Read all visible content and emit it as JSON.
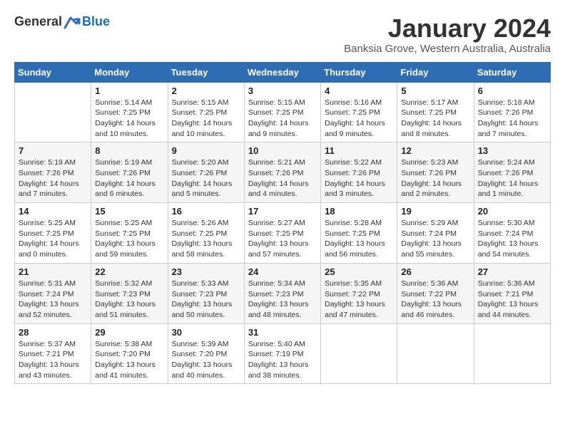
{
  "header": {
    "logo_general": "General",
    "logo_blue": "Blue",
    "month_year": "January 2024",
    "location": "Banksia Grove, Western Australia, Australia"
  },
  "calendar": {
    "headers": [
      "Sunday",
      "Monday",
      "Tuesday",
      "Wednesday",
      "Thursday",
      "Friday",
      "Saturday"
    ],
    "weeks": [
      [
        {
          "day": "",
          "info": ""
        },
        {
          "day": "1",
          "info": "Sunrise: 5:14 AM\nSunset: 7:25 PM\nDaylight: 14 hours\nand 10 minutes."
        },
        {
          "day": "2",
          "info": "Sunrise: 5:15 AM\nSunset: 7:25 PM\nDaylight: 14 hours\nand 10 minutes."
        },
        {
          "day": "3",
          "info": "Sunrise: 5:15 AM\nSunset: 7:25 PM\nDaylight: 14 hours\nand 9 minutes."
        },
        {
          "day": "4",
          "info": "Sunrise: 5:16 AM\nSunset: 7:25 PM\nDaylight: 14 hours\nand 9 minutes."
        },
        {
          "day": "5",
          "info": "Sunrise: 5:17 AM\nSunset: 7:25 PM\nDaylight: 14 hours\nand 8 minutes."
        },
        {
          "day": "6",
          "info": "Sunrise: 5:18 AM\nSunset: 7:26 PM\nDaylight: 14 hours\nand 7 minutes."
        }
      ],
      [
        {
          "day": "7",
          "info": "Sunrise: 5:19 AM\nSunset: 7:26 PM\nDaylight: 14 hours\nand 7 minutes."
        },
        {
          "day": "8",
          "info": "Sunrise: 5:19 AM\nSunset: 7:26 PM\nDaylight: 14 hours\nand 6 minutes."
        },
        {
          "day": "9",
          "info": "Sunrise: 5:20 AM\nSunset: 7:26 PM\nDaylight: 14 hours\nand 5 minutes."
        },
        {
          "day": "10",
          "info": "Sunrise: 5:21 AM\nSunset: 7:26 PM\nDaylight: 14 hours\nand 4 minutes."
        },
        {
          "day": "11",
          "info": "Sunrise: 5:22 AM\nSunset: 7:26 PM\nDaylight: 14 hours\nand 3 minutes."
        },
        {
          "day": "12",
          "info": "Sunrise: 5:23 AM\nSunset: 7:26 PM\nDaylight: 14 hours\nand 2 minutes."
        },
        {
          "day": "13",
          "info": "Sunrise: 5:24 AM\nSunset: 7:26 PM\nDaylight: 14 hours\nand 1 minute."
        }
      ],
      [
        {
          "day": "14",
          "info": "Sunrise: 5:25 AM\nSunset: 7:25 PM\nDaylight: 14 hours\nand 0 minutes."
        },
        {
          "day": "15",
          "info": "Sunrise: 5:25 AM\nSunset: 7:25 PM\nDaylight: 13 hours\nand 59 minutes."
        },
        {
          "day": "16",
          "info": "Sunrise: 5:26 AM\nSunset: 7:25 PM\nDaylight: 13 hours\nand 58 minutes."
        },
        {
          "day": "17",
          "info": "Sunrise: 5:27 AM\nSunset: 7:25 PM\nDaylight: 13 hours\nand 57 minutes."
        },
        {
          "day": "18",
          "info": "Sunrise: 5:28 AM\nSunset: 7:25 PM\nDaylight: 13 hours\nand 56 minutes."
        },
        {
          "day": "19",
          "info": "Sunrise: 5:29 AM\nSunset: 7:24 PM\nDaylight: 13 hours\nand 55 minutes."
        },
        {
          "day": "20",
          "info": "Sunrise: 5:30 AM\nSunset: 7:24 PM\nDaylight: 13 hours\nand 54 minutes."
        }
      ],
      [
        {
          "day": "21",
          "info": "Sunrise: 5:31 AM\nSunset: 7:24 PM\nDaylight: 13 hours\nand 52 minutes."
        },
        {
          "day": "22",
          "info": "Sunrise: 5:32 AM\nSunset: 7:23 PM\nDaylight: 13 hours\nand 51 minutes."
        },
        {
          "day": "23",
          "info": "Sunrise: 5:33 AM\nSunset: 7:23 PM\nDaylight: 13 hours\nand 50 minutes."
        },
        {
          "day": "24",
          "info": "Sunrise: 5:34 AM\nSunset: 7:23 PM\nDaylight: 13 hours\nand 48 minutes."
        },
        {
          "day": "25",
          "info": "Sunrise: 5:35 AM\nSunset: 7:22 PM\nDaylight: 13 hours\nand 47 minutes."
        },
        {
          "day": "26",
          "info": "Sunrise: 5:36 AM\nSunset: 7:22 PM\nDaylight: 13 hours\nand 46 minutes."
        },
        {
          "day": "27",
          "info": "Sunrise: 5:36 AM\nSunset: 7:21 PM\nDaylight: 13 hours\nand 44 minutes."
        }
      ],
      [
        {
          "day": "28",
          "info": "Sunrise: 5:37 AM\nSunset: 7:21 PM\nDaylight: 13 hours\nand 43 minutes."
        },
        {
          "day": "29",
          "info": "Sunrise: 5:38 AM\nSunset: 7:20 PM\nDaylight: 13 hours\nand 41 minutes."
        },
        {
          "day": "30",
          "info": "Sunrise: 5:39 AM\nSunset: 7:20 PM\nDaylight: 13 hours\nand 40 minutes."
        },
        {
          "day": "31",
          "info": "Sunrise: 5:40 AM\nSunset: 7:19 PM\nDaylight: 13 hours\nand 38 minutes."
        },
        {
          "day": "",
          "info": ""
        },
        {
          "day": "",
          "info": ""
        },
        {
          "day": "",
          "info": ""
        }
      ]
    ]
  }
}
